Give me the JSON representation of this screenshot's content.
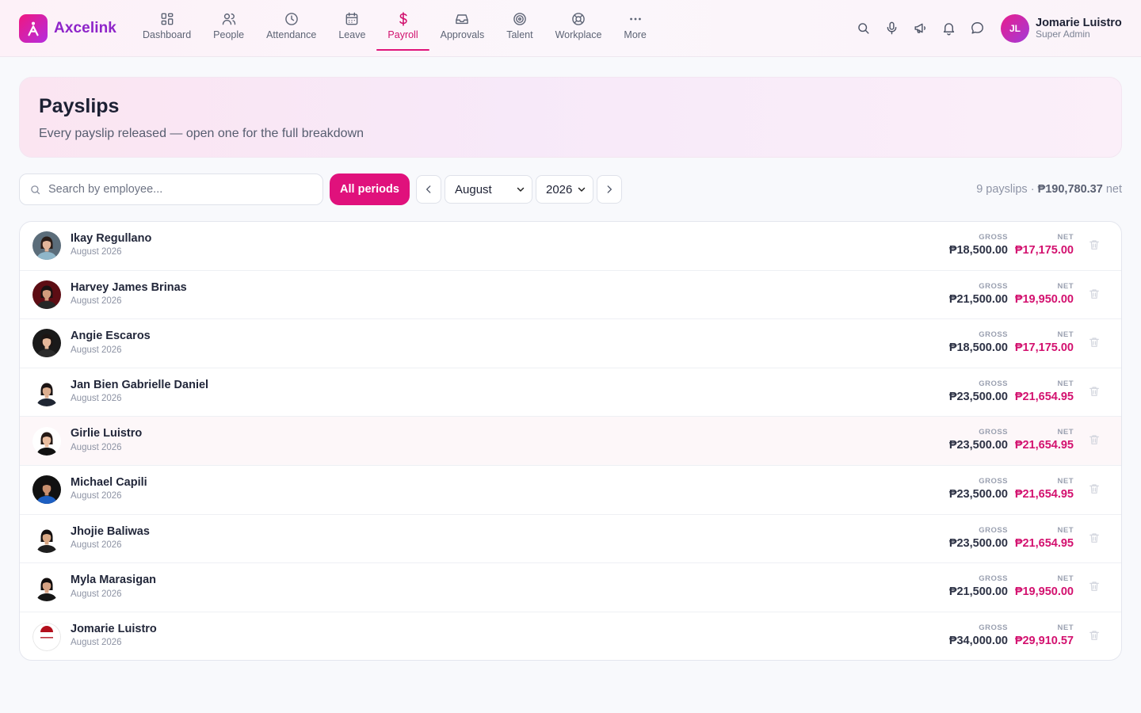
{
  "brand": {
    "name": "Axcelink"
  },
  "nav": [
    {
      "label": "Dashboard",
      "icon": "grid-icon"
    },
    {
      "label": "People",
      "icon": "users-icon"
    },
    {
      "label": "Attendance",
      "icon": "clock-icon"
    },
    {
      "label": "Leave",
      "icon": "calendar-icon"
    },
    {
      "label": "Payroll",
      "icon": "dollar-icon",
      "active": true
    },
    {
      "label": "Approvals",
      "icon": "inbox-icon"
    },
    {
      "label": "Talent",
      "icon": "target-icon"
    },
    {
      "label": "Workplace",
      "icon": "lifebuoy-icon"
    },
    {
      "label": "More",
      "icon": "more-icon"
    }
  ],
  "user": {
    "initials": "JL",
    "name": "Jomarie Luistro",
    "role": "Super Admin"
  },
  "hero": {
    "title": "Payslips",
    "subtitle": "Every payslip released — open one for the full breakdown"
  },
  "filters": {
    "search_placeholder": "Search by employee...",
    "all_periods_label": "All periods",
    "month": "August",
    "year": "2026"
  },
  "summary": {
    "count_text": "9 payslips · ",
    "net_amount": "₱190,780.37",
    "net_suffix": " net"
  },
  "columns": {
    "gross_label": "GROSS",
    "net_label": "NET"
  },
  "payslips": [
    {
      "name": "Ikay Regullano",
      "period": "August 2026",
      "gross": "₱18,500.00",
      "net": "₱17,175.00"
    },
    {
      "name": "Harvey James Brinas",
      "period": "August 2026",
      "gross": "₱21,500.00",
      "net": "₱19,950.00"
    },
    {
      "name": "Angie Escaros",
      "period": "August 2026",
      "gross": "₱18,500.00",
      "net": "₱17,175.00"
    },
    {
      "name": "Jan Bien Gabrielle Daniel",
      "period": "August 2026",
      "gross": "₱23,500.00",
      "net": "₱21,654.95"
    },
    {
      "name": "Girlie Luistro",
      "period": "August 2026",
      "gross": "₱23,500.00",
      "net": "₱21,654.95"
    },
    {
      "name": "Michael Capili",
      "period": "August 2026",
      "gross": "₱23,500.00",
      "net": "₱21,654.95"
    },
    {
      "name": "Jhojie Baliwas",
      "period": "August 2026",
      "gross": "₱23,500.00",
      "net": "₱21,654.95"
    },
    {
      "name": "Myla Marasigan",
      "period": "August 2026",
      "gross": "₱21,500.00",
      "net": "₱19,950.00"
    },
    {
      "name": "Jomarie Luistro",
      "period": "August 2026",
      "gross": "₱34,000.00",
      "net": "₱29,910.57"
    }
  ],
  "colors": {
    "accent": "#e0117c",
    "brand": "#8e24c9",
    "net": "#d3116f"
  }
}
